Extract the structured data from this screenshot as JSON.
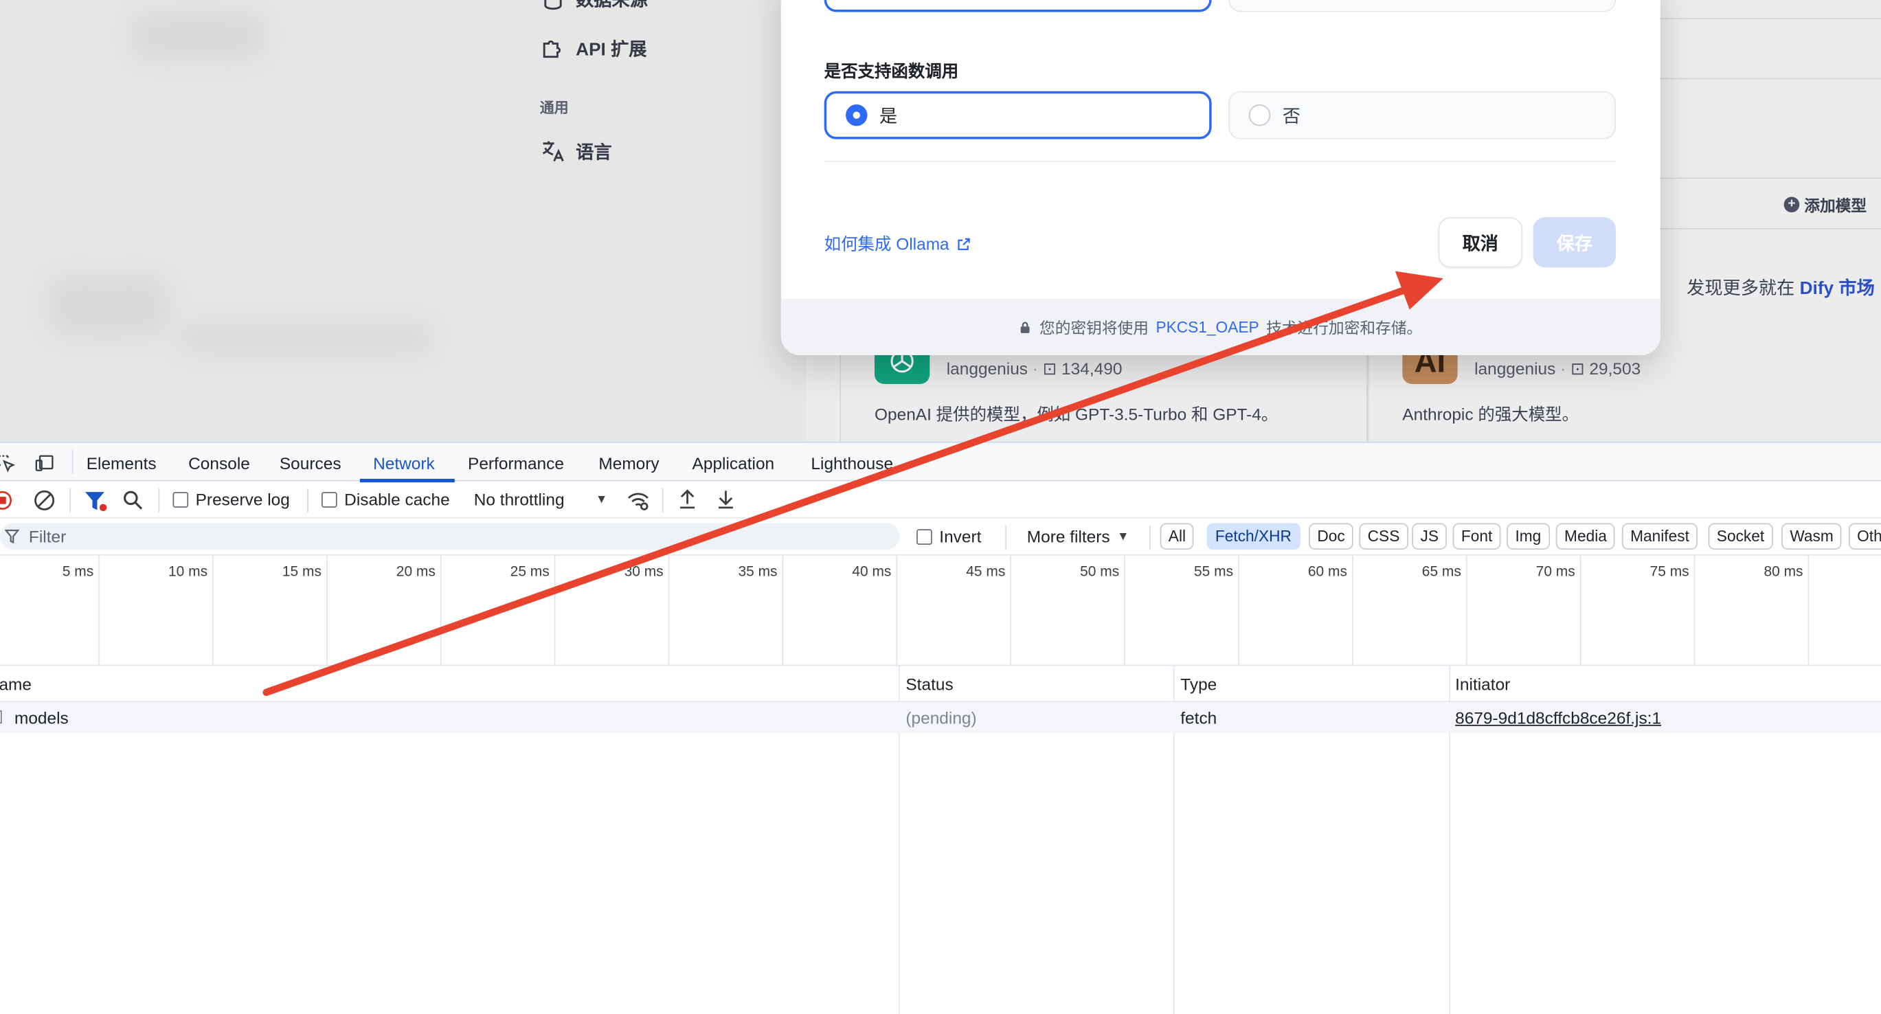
{
  "sidebar": {
    "items": [
      {
        "label": "数据来源",
        "icon": "database-icon"
      },
      {
        "label": "API 扩展",
        "icon": "puzzle-icon"
      },
      {
        "label": "语言",
        "icon": "translate-icon"
      }
    ],
    "section_general": "通用"
  },
  "main": {
    "add_model": "添加模型",
    "discover_prefix": "发现更多就在",
    "discover_link": "Dify 市场",
    "cards": [
      {
        "author": "langgenius",
        "installs": "134,490",
        "description": "OpenAI 提供的模型，例如 GPT-3.5-Turbo 和 GPT-4。",
        "logo": "openai-logo",
        "logo_color": "#10a37f"
      },
      {
        "author": "langgenius",
        "installs": "29,503",
        "description": "Anthropic 的强大模型。",
        "logo": "anthropic-logo",
        "logo_color": "#c08a5b",
        "logo_text": "AI"
      }
    ]
  },
  "modal": {
    "function_call_label": "是否支持函数调用",
    "option_yes": "是",
    "option_no": "否",
    "help_link": "如何集成 Ollama",
    "cancel": "取消",
    "save": "保存",
    "footer_prefix": "您的密钥将使用",
    "footer_link": "PKCS1_OAEP",
    "footer_suffix": "技术进行加密和存储。"
  },
  "devtools": {
    "tabs": [
      "Elements",
      "Console",
      "Sources",
      "Network",
      "Performance",
      "Memory",
      "Application",
      "Lighthouse"
    ],
    "active_tab": "Network",
    "toolbar": {
      "preserve_log": "Preserve log",
      "disable_cache": "Disable cache",
      "throttling": "No throttling"
    },
    "filter": {
      "placeholder": "Filter",
      "invert": "Invert",
      "more_filters": "More filters",
      "types": [
        "All",
        "Fetch/XHR",
        "Doc",
        "CSS",
        "JS",
        "Font",
        "Img",
        "Media",
        "Manifest",
        "Socket",
        "Wasm",
        "Oth"
      ],
      "active_type": "Fetch/XHR"
    },
    "timeline_ticks": [
      "5 ms",
      "10 ms",
      "15 ms",
      "20 ms",
      "25 ms",
      "30 ms",
      "35 ms",
      "40 ms",
      "45 ms",
      "50 ms",
      "55 ms",
      "60 ms",
      "65 ms",
      "70 ms",
      "75 ms",
      "80 ms"
    ],
    "columns": [
      "lame",
      "Status",
      "Type",
      "Initiator"
    ],
    "rows": [
      {
        "name": "models",
        "status": "(pending)",
        "type": "fetch",
        "initiator": "8679-9d1d8cffcb8ce26f.js:1"
      }
    ]
  },
  "colors": {
    "accent": "#2e6af6",
    "devtools_accent": "#1a56c8",
    "arrow": "#e8432e"
  }
}
